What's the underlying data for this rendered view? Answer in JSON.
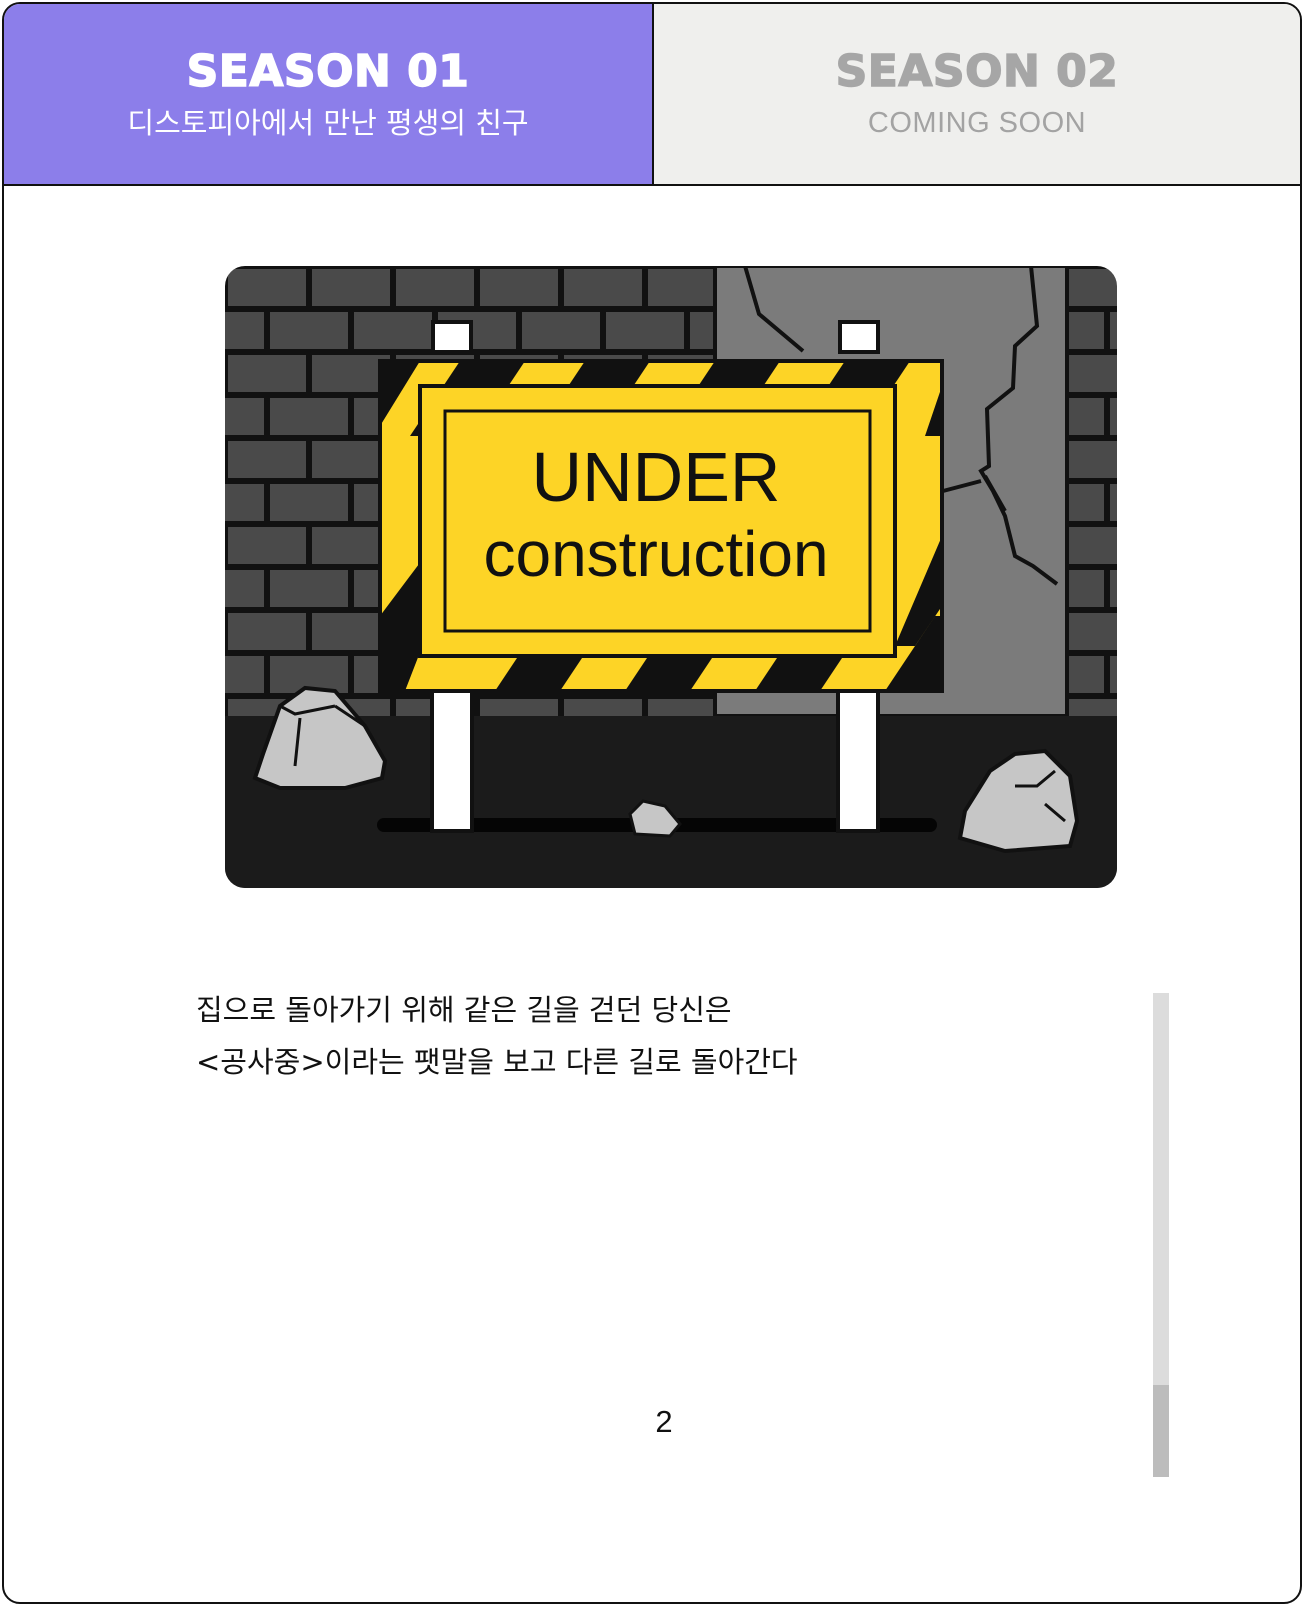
{
  "tabs": [
    {
      "title": "SEASON 01",
      "subtitle": "디스토피아에서 만난 평생의 친구",
      "active": true
    },
    {
      "title": "SEASON 02",
      "subtitle": "COMING SOON",
      "active": false
    }
  ],
  "illustration": {
    "sign_line1": "UNDER",
    "sign_line2": "construction"
  },
  "story": {
    "lines": [
      "집으로 돌아가기 위해 같은 길을 걷던 당신은",
      "<공사중>이라는 팻말을 보고 다른 길로 돌아간다"
    ]
  },
  "page_number": "2",
  "scrollbar": {
    "thumb_fraction": 0.19
  },
  "colors": {
    "active_tab": "#8c7eea",
    "inactive_tab": "#efefed",
    "sign_yellow": "#fdd426",
    "brick": "#4a4a4a",
    "ground": "#1b1b1b"
  }
}
